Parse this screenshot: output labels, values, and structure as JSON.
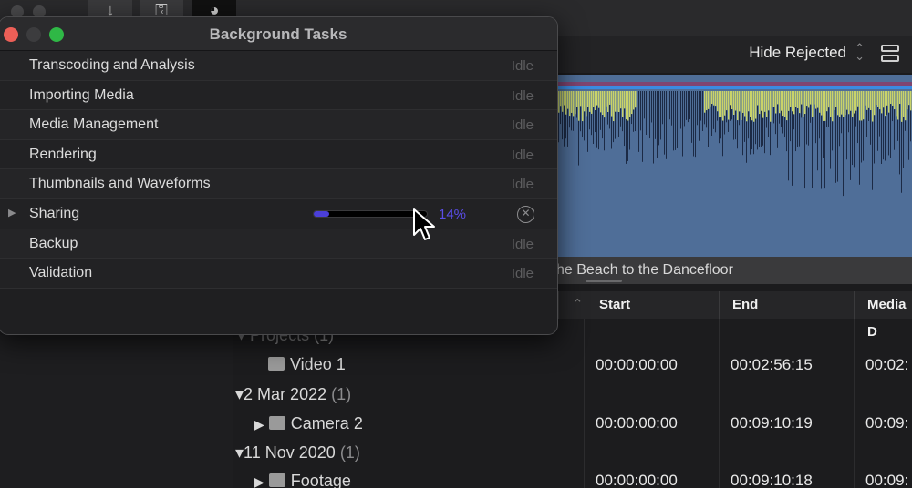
{
  "background_tasks": {
    "title": "Background Tasks",
    "tasks": [
      {
        "label": "Transcoding and Analysis",
        "status": "Idle"
      },
      {
        "label": "Importing Media",
        "status": "Idle"
      },
      {
        "label": "Media Management",
        "status": "Idle"
      },
      {
        "label": "Rendering",
        "status": "Idle"
      },
      {
        "label": "Thumbnails and Waveforms",
        "status": "Idle"
      },
      {
        "label": "Sharing",
        "progress_percent": 14,
        "progress_label": "14%"
      },
      {
        "label": "Backup",
        "status": "Idle"
      },
      {
        "label": "Validation",
        "status": "Idle"
      }
    ]
  },
  "browser": {
    "filter_label": "Hide Rejected",
    "clip_title": "he Beach to the Dancefloor",
    "columns": [
      "Start",
      "End",
      "Media D"
    ],
    "rows": [
      {
        "label": "Projects",
        "count": "(1)"
      },
      {
        "label": "Video 1",
        "start": "00:00:00:00",
        "end": "00:02:56:15",
        "media": "00:02:"
      },
      {
        "label": "2 Mar 2022",
        "count": "(1)"
      },
      {
        "label": "Camera 2",
        "start": "00:00:00:00",
        "end": "00:09:10:19",
        "media": "00:09:"
      },
      {
        "label": "11 Nov 2020",
        "count": "(1)"
      },
      {
        "label": "Footage",
        "start": "00:00:00:00",
        "end": "00:09:10:18",
        "media": "00:09:"
      }
    ]
  },
  "colors": {
    "close": "#ec5f57",
    "maximize": "#2fb846",
    "progress": "#4b3fd8",
    "waveform_bg": "#4f6e98"
  },
  "icons": [
    "download-icon",
    "key-icon",
    "background-tasks-icon",
    "close-icon",
    "cancel-icon",
    "disclosure-triangle-icon",
    "clapper-icon",
    "film-icon",
    "cursor-icon"
  ]
}
